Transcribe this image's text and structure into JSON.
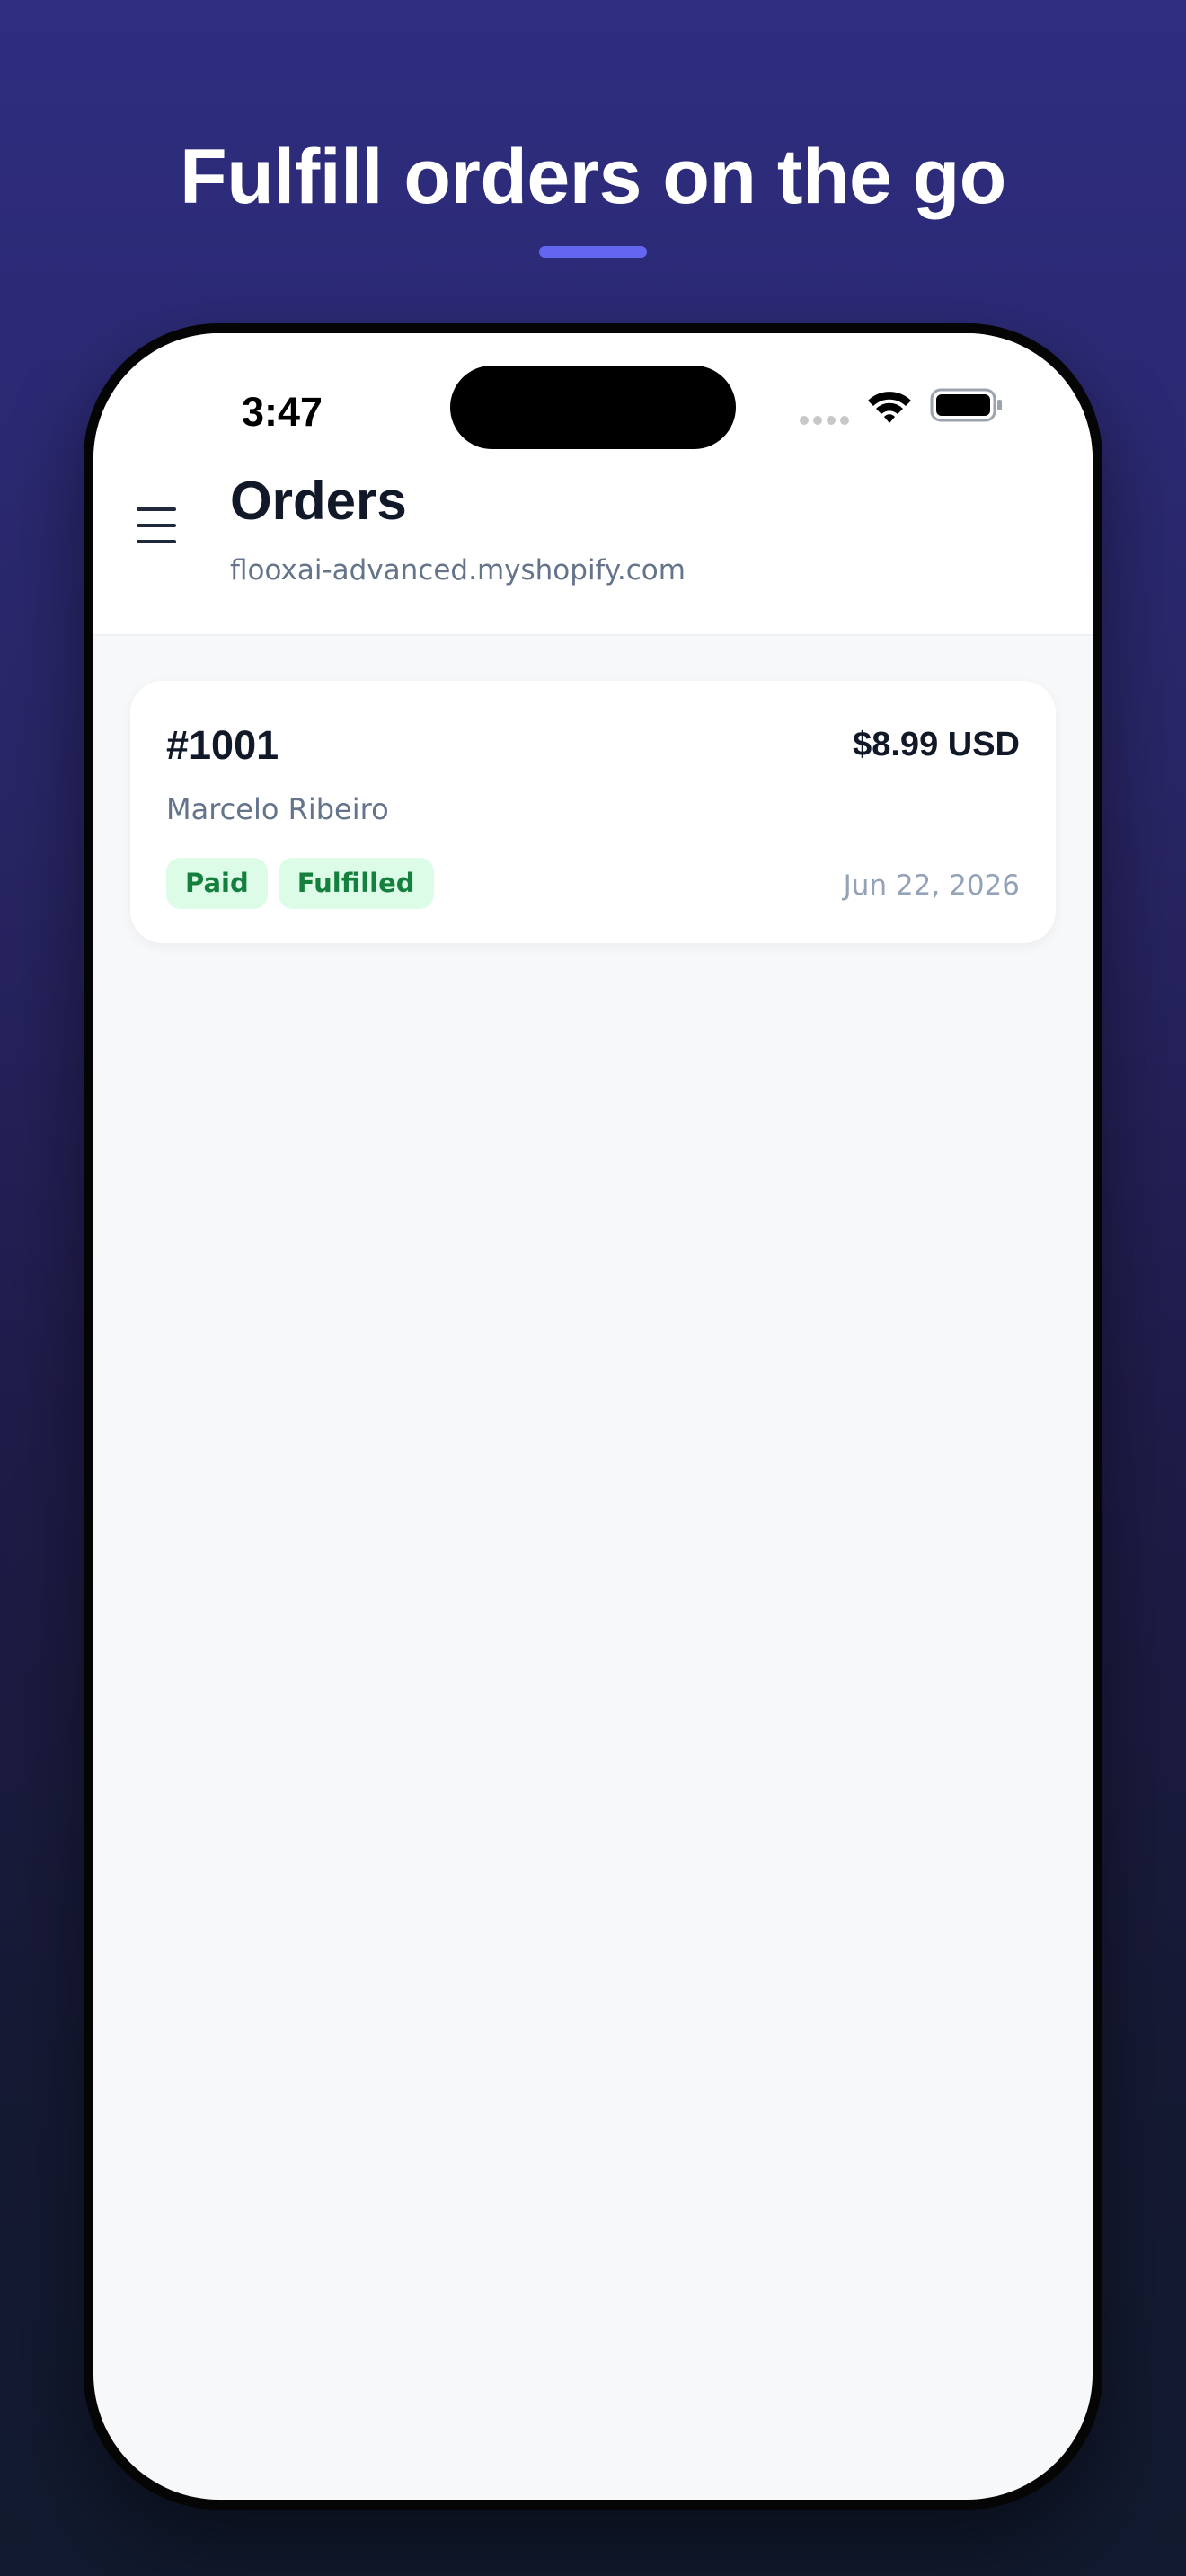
{
  "promo": {
    "headline": "Fulfill orders on the go",
    "accent_color": "#6366f1"
  },
  "status_bar": {
    "time": "3:47",
    "icons": [
      "cellular-signal-icon",
      "wifi-icon",
      "battery-icon"
    ]
  },
  "header": {
    "menu_icon": "hamburger-menu-icon",
    "title": "Orders",
    "store_domain": "flooxai-advanced.myshopify.com"
  },
  "orders": [
    {
      "number": "#1001",
      "total": "$8.99 USD",
      "customer": "Marcelo Ribeiro",
      "badges": [
        "Paid",
        "Fulfilled"
      ],
      "date": "Jun 22, 2026",
      "badge_bg": "#dcfce7",
      "badge_color": "#15803d"
    }
  ]
}
